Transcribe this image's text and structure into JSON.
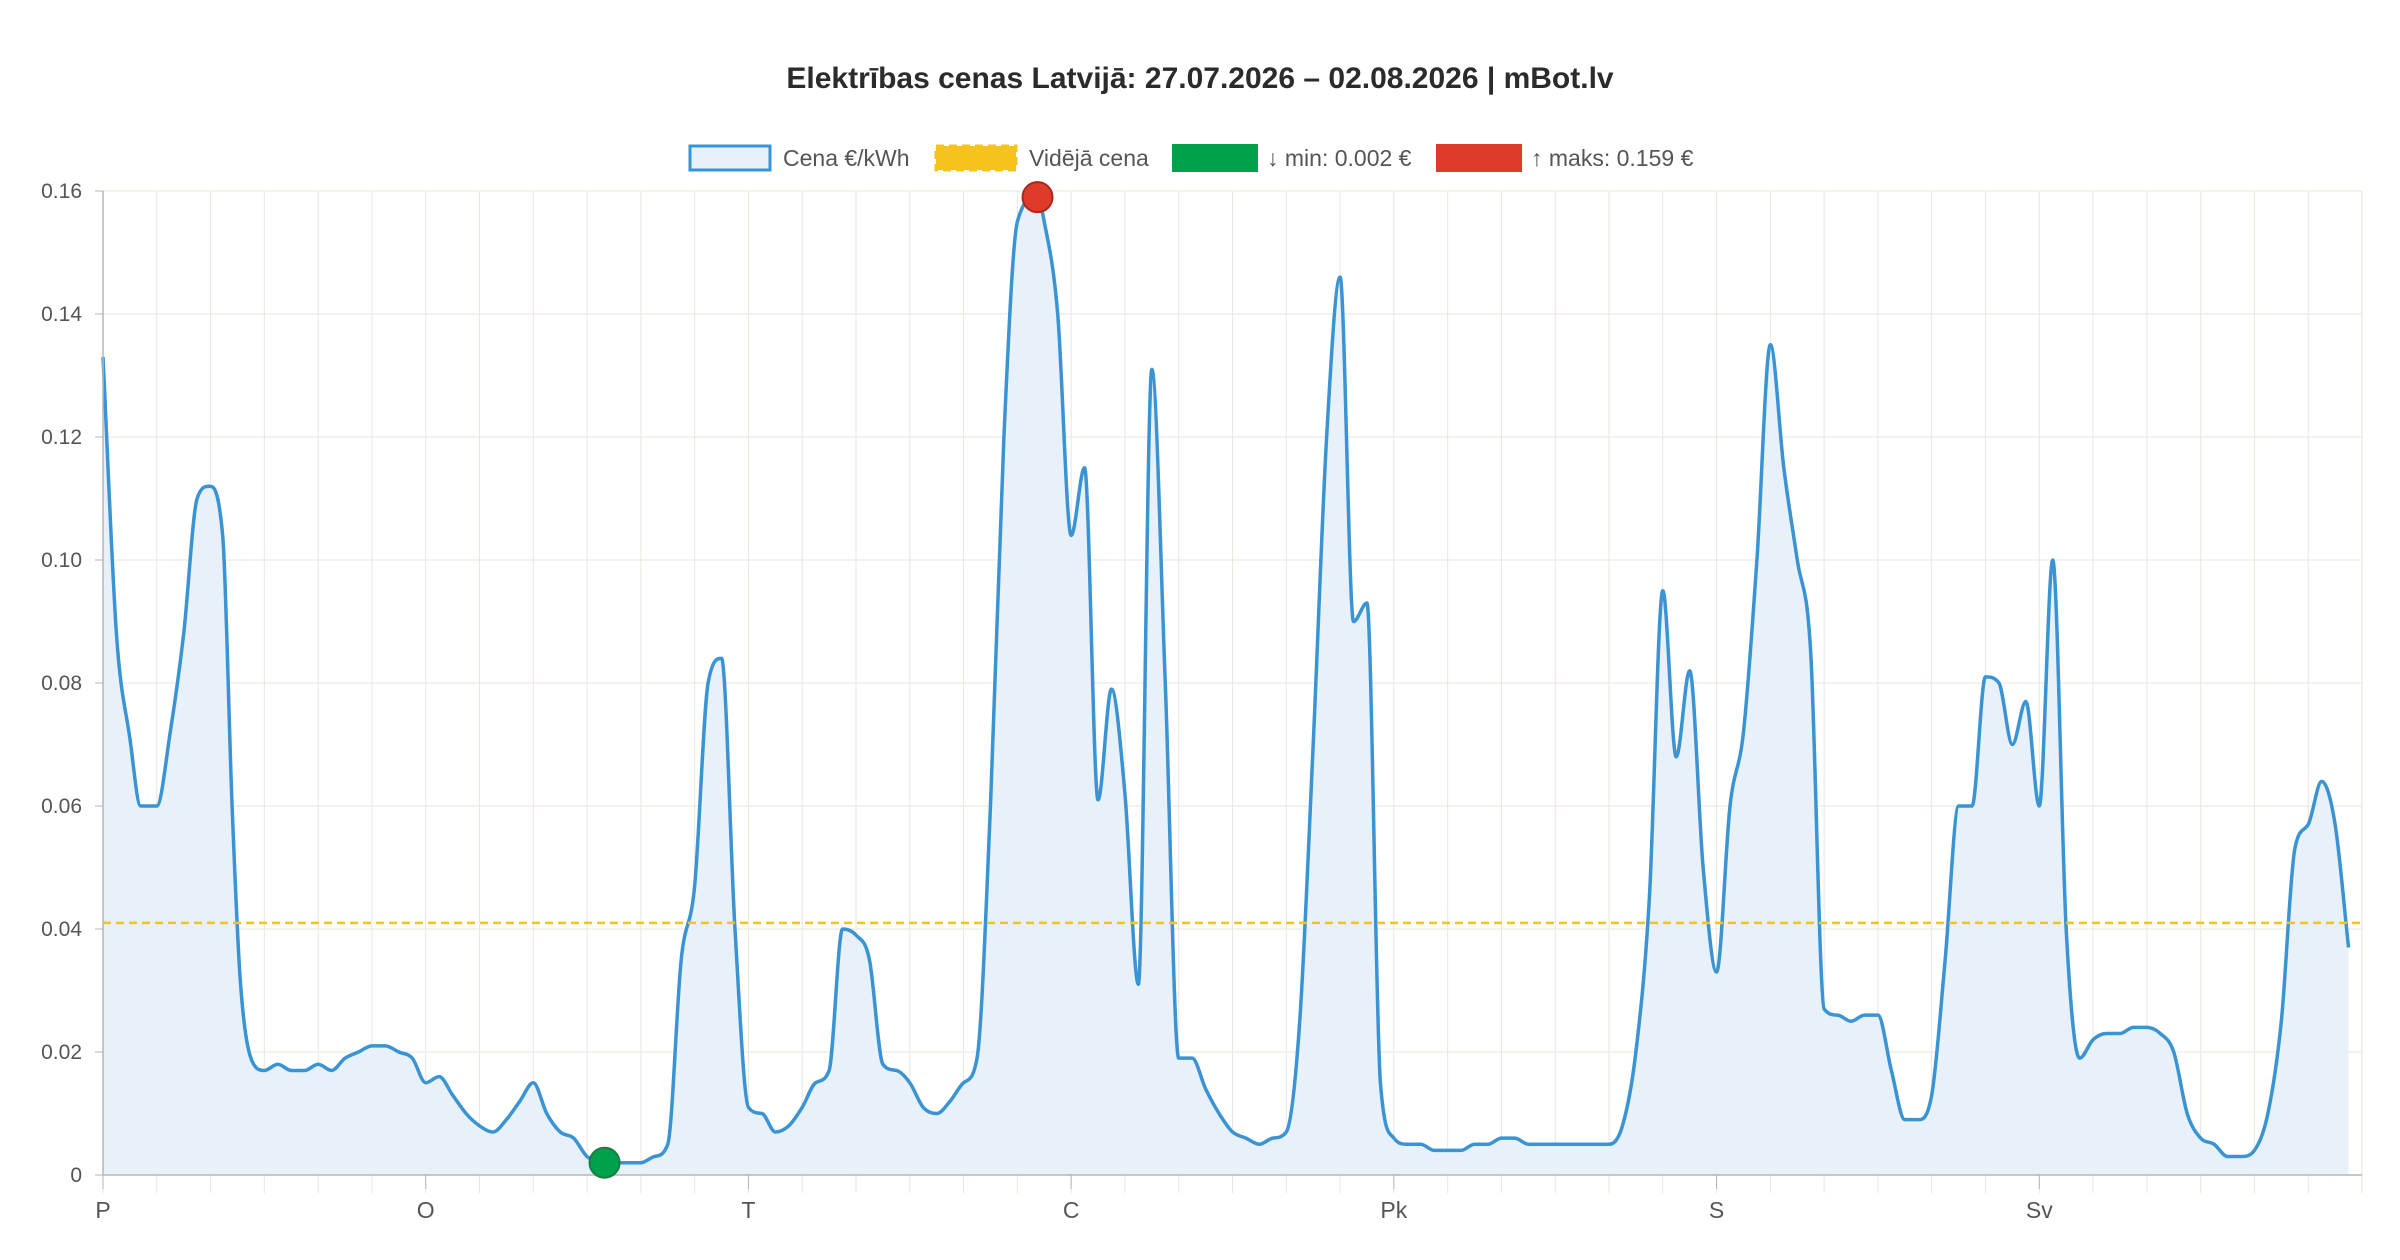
{
  "colors": {
    "line": "#3a93d2",
    "fill": "#e8f1fa",
    "average": "#f6c31c",
    "min": "#00a14b",
    "max": "#df3b2a",
    "grid": "#ebe6de",
    "axis": "#b5b5b5",
    "text": "#555555"
  },
  "chart_data": {
    "type": "area",
    "title": "Elektrības cenas Latvijā: 27.07.2026 – 02.08.2026 | mBot.lv",
    "xlabel": "",
    "ylabel": "",
    "ylim": [
      0,
      0.16
    ],
    "yticks": [
      "0",
      "0.02",
      "0.04",
      "0.06",
      "0.08",
      "0.10",
      "0.12",
      "0.14",
      "0.16"
    ],
    "xlim": [
      0,
      168
    ],
    "day_labels": [
      "P",
      "O",
      "T",
      "C",
      "Pk",
      "S",
      "Sv"
    ],
    "grid": true,
    "legend_position": "top",
    "legend": [
      {
        "label": "Cena €/kWh",
        "kind": "line-box"
      },
      {
        "label": "Vidējā cena",
        "kind": "average"
      },
      {
        "label": "↓ min: 0.002 €",
        "kind": "min"
      },
      {
        "label": "↑ maks: 0.159 €",
        "kind": "max"
      }
    ],
    "average": 0.041,
    "min_point": {
      "x": 37.3,
      "y": 0.002
    },
    "max_point": {
      "x": 69.5,
      "y": 0.159
    },
    "series": [
      {
        "points": [
          [
            0,
            0.133
          ],
          [
            1,
            0.088
          ],
          [
            2,
            0.071
          ],
          [
            2.8,
            0.06
          ],
          [
            4,
            0.06
          ],
          [
            5,
            0.072
          ],
          [
            6,
            0.088
          ],
          [
            7,
            0.11
          ],
          [
            7.9,
            0.112
          ],
          [
            8.9,
            0.104
          ],
          [
            9.6,
            0.06
          ],
          [
            10.2,
            0.032
          ],
          [
            11,
            0.019
          ],
          [
            12,
            0.017
          ],
          [
            13,
            0.018
          ],
          [
            14,
            0.017
          ],
          [
            15,
            0.017
          ],
          [
            16,
            0.018
          ],
          [
            17,
            0.017
          ],
          [
            18,
            0.019
          ],
          [
            19,
            0.02
          ],
          [
            20,
            0.021
          ],
          [
            21,
            0.021
          ],
          [
            22,
            0.02
          ],
          [
            23,
            0.019
          ],
          [
            24,
            0.015
          ],
          [
            25,
            0.016
          ],
          [
            26,
            0.013
          ],
          [
            27,
            0.01
          ],
          [
            28,
            0.008
          ],
          [
            29,
            0.007
          ],
          [
            30,
            0.009
          ],
          [
            31,
            0.012
          ],
          [
            32,
            0.015
          ],
          [
            33,
            0.01
          ],
          [
            34,
            0.007
          ],
          [
            35,
            0.006
          ],
          [
            36,
            0.003
          ],
          [
            37.3,
            0.002
          ],
          [
            38,
            0.002
          ],
          [
            39,
            0.002
          ],
          [
            40,
            0.002
          ],
          [
            41,
            0.003
          ],
          [
            42,
            0.005
          ],
          [
            43,
            0.035
          ],
          [
            44,
            0.047
          ],
          [
            45,
            0.08
          ],
          [
            46,
            0.084
          ],
          [
            47,
            0.04
          ],
          [
            48,
            0.011
          ],
          [
            49,
            0.01
          ],
          [
            50,
            0.007
          ],
          [
            51,
            0.008
          ],
          [
            52,
            0.011
          ],
          [
            53,
            0.015
          ],
          [
            54,
            0.017
          ],
          [
            55,
            0.04
          ],
          [
            56,
            0.039
          ],
          [
            57,
            0.035
          ],
          [
            58,
            0.018
          ],
          [
            59,
            0.017
          ],
          [
            60,
            0.015
          ],
          [
            61,
            0.011
          ],
          [
            62,
            0.01
          ],
          [
            63,
            0.012
          ],
          [
            64,
            0.015
          ],
          [
            65,
            0.019
          ],
          [
            66,
            0.06
          ],
          [
            67,
            0.12
          ],
          [
            68,
            0.155
          ],
          [
            69.5,
            0.159
          ],
          [
            70,
            0.155
          ],
          [
            71,
            0.14
          ],
          [
            72,
            0.104
          ],
          [
            73,
            0.115
          ],
          [
            74,
            0.061
          ],
          [
            75,
            0.079
          ],
          [
            76,
            0.062
          ],
          [
            77,
            0.031
          ],
          [
            78,
            0.131
          ],
          [
            79,
            0.08
          ],
          [
            80,
            0.019
          ],
          [
            81,
            0.019
          ],
          [
            82,
            0.014
          ],
          [
            83,
            0.01
          ],
          [
            84,
            0.007
          ],
          [
            85,
            0.006
          ],
          [
            86,
            0.005
          ],
          [
            87,
            0.006
          ],
          [
            88,
            0.007
          ],
          [
            89,
            0.025
          ],
          [
            90,
            0.07
          ],
          [
            91,
            0.12
          ],
          [
            92,
            0.146
          ],
          [
            93,
            0.09
          ],
          [
            94,
            0.093
          ],
          [
            95,
            0.015
          ],
          [
            96,
            0.006
          ],
          [
            97,
            0.005
          ],
          [
            98,
            0.005
          ],
          [
            99,
            0.004
          ],
          [
            100,
            0.004
          ],
          [
            101,
            0.004
          ],
          [
            102,
            0.005
          ],
          [
            103,
            0.005
          ],
          [
            104,
            0.006
          ],
          [
            105,
            0.006
          ],
          [
            106,
            0.005
          ],
          [
            107,
            0.005
          ],
          [
            108,
            0.005
          ],
          [
            109,
            0.005
          ],
          [
            110,
            0.005
          ],
          [
            111,
            0.005
          ],
          [
            112,
            0.005
          ],
          [
            113,
            0.008
          ],
          [
            114,
            0.02
          ],
          [
            115,
            0.045
          ],
          [
            116,
            0.095
          ],
          [
            117,
            0.068
          ],
          [
            118,
            0.082
          ],
          [
            119,
            0.05
          ],
          [
            120,
            0.033
          ],
          [
            121,
            0.06
          ],
          [
            122,
            0.072
          ],
          [
            123,
            0.1
          ],
          [
            124,
            0.135
          ],
          [
            125,
            0.115
          ],
          [
            126,
            0.1
          ],
          [
            127,
            0.085
          ],
          [
            128,
            0.027
          ],
          [
            129,
            0.026
          ],
          [
            130,
            0.025
          ],
          [
            131,
            0.026
          ],
          [
            132,
            0.026
          ],
          [
            133,
            0.017
          ],
          [
            134,
            0.009
          ],
          [
            135,
            0.009
          ],
          [
            136,
            0.013
          ],
          [
            137,
            0.035
          ],
          [
            138,
            0.06
          ],
          [
            139,
            0.06
          ],
          [
            140,
            0.081
          ],
          [
            141,
            0.08
          ],
          [
            142,
            0.07
          ],
          [
            143,
            0.077
          ],
          [
            144,
            0.06
          ],
          [
            145,
            0.1
          ],
          [
            146,
            0.04
          ],
          [
            147,
            0.019
          ],
          [
            148,
            0.022
          ],
          [
            149,
            0.023
          ],
          [
            150,
            0.023
          ],
          [
            151,
            0.024
          ],
          [
            152,
            0.024
          ],
          [
            153,
            0.023
          ],
          [
            154,
            0.02
          ],
          [
            155,
            0.01
          ],
          [
            156,
            0.006
          ],
          [
            157,
            0.005
          ],
          [
            158,
            0.003
          ],
          [
            159,
            0.003
          ],
          [
            160,
            0.004
          ],
          [
            161,
            0.01
          ],
          [
            162,
            0.025
          ],
          [
            163,
            0.053
          ],
          [
            164,
            0.057
          ],
          [
            165,
            0.064
          ],
          [
            166,
            0.057
          ],
          [
            167,
            0.037
          ]
        ]
      }
    ]
  }
}
